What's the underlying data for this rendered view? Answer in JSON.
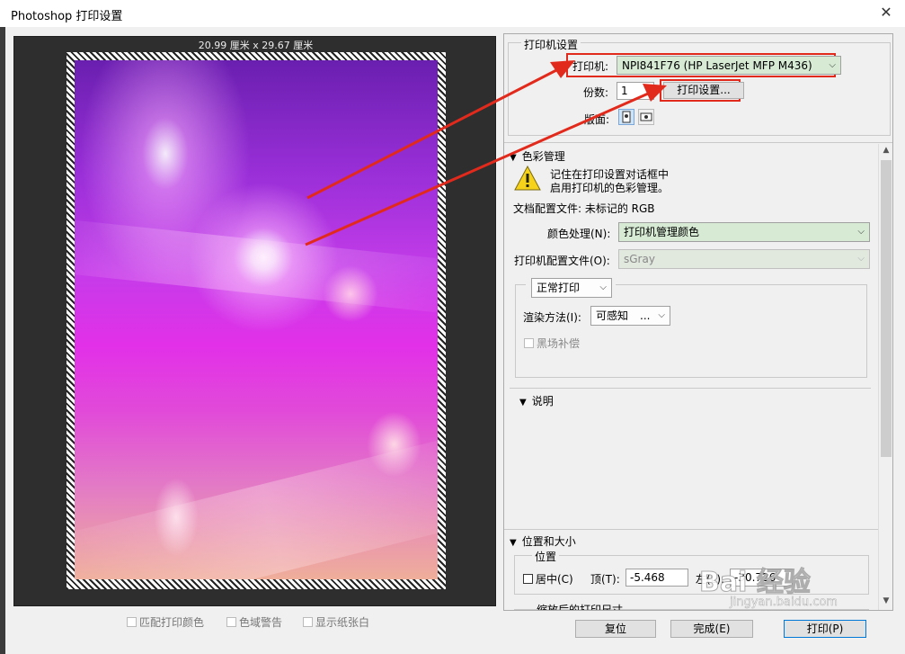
{
  "window": {
    "title": "Photoshop 打印设置",
    "close_glyph": "✕"
  },
  "preview": {
    "dimensions": "20.99 厘米 x 29.67 厘米"
  },
  "bottom_options": [
    {
      "label": "匹配打印颜色"
    },
    {
      "label": "色域警告"
    },
    {
      "label": "显示纸张白"
    }
  ],
  "printer_settings": {
    "section_title": "打印机设置",
    "printer_label": "打印机:",
    "printer_value": "NPI841F76 (HP LaserJet MFP M436)",
    "copies_label": "份数:",
    "copies_value": "1",
    "print_settings_button": "打印设置...",
    "layout_label": "版面:"
  },
  "color_management": {
    "section_title": "色彩管理",
    "warning_line1": "记住在打印设置对话框中",
    "warning_line2": "启用打印机的色彩管理。",
    "doc_profile": "文档配置文件: 未标记的 RGB",
    "color_handling_label": "颜色处理(N):",
    "color_handling_value": "打印机管理颜色",
    "printer_profile_label": "打印机配置文件(O):",
    "printer_profile_value": "sGray",
    "normal_print_value": "正常打印",
    "rendering_label": "渲染方法(I):",
    "rendering_value": "可感知",
    "rendering_ellipsis": "...",
    "black_point_label": "黑场补偿"
  },
  "description": {
    "section_title": "说明"
  },
  "position_size": {
    "section_title": "位置和大小",
    "position_legend": "位置",
    "center_label": "居中(C)",
    "top_label": "顶(T):",
    "top_value": "-5.468",
    "left_label": "左(L):",
    "left_value": "-30.726",
    "scaled_label": "缩放后的打印尺寸"
  },
  "buttons": {
    "reset": "复位",
    "done": "完成(E)",
    "print": "打印(P)"
  },
  "watermark": {
    "logo": "Bai 经验",
    "url": "jingyan.baidu.com"
  },
  "colors": {
    "annotation_red": "#e22a1c",
    "select_green": "#d6ead4"
  }
}
